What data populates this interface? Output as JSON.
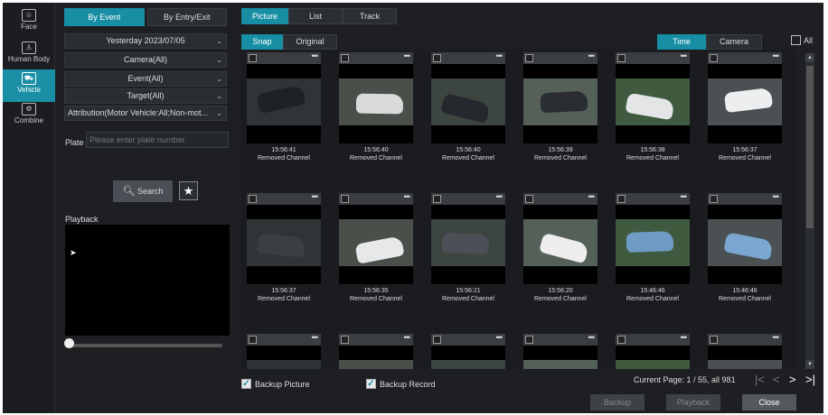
{
  "nav": [
    {
      "label": "Face",
      "icon": "face-icon",
      "glyph": "☺"
    },
    {
      "label": "Human Body",
      "icon": "human-body-icon",
      "glyph": "♙"
    },
    {
      "label": "Vehicle",
      "icon": "vehicle-icon",
      "glyph": "⛟"
    },
    {
      "label": "Combine",
      "icon": "combine-icon",
      "glyph": "⚙"
    }
  ],
  "left": {
    "tabs": [
      "By Event",
      "By Entry/Exit"
    ],
    "date": "Yesterday 2023/07/05",
    "camera": "Camera(All)",
    "event": "Event(All)",
    "target": "Target(All)",
    "attribution": "Attribution(Motor Vehicle:All;Non-mot...",
    "plate_label": "Plate",
    "plate_placeholder": "Please enter plate number",
    "search_label": "Search",
    "playback_label": "Playback"
  },
  "main": {
    "view_tabs": [
      "Picture",
      "List",
      "Track"
    ],
    "mode_tabs": [
      "Snap",
      "Original"
    ],
    "sort": {
      "time": "Time",
      "camera": "Camera"
    },
    "all_label": "All",
    "cards": [
      {
        "time": "15:56:41",
        "channel": "Removed Channel",
        "color": "#1e2226"
      },
      {
        "time": "15:56:40",
        "channel": "Removed Channel",
        "color": "#d8dadc"
      },
      {
        "time": "15:56:40",
        "channel": "Removed Channel",
        "color": "#25292d"
      },
      {
        "time": "15:56:39",
        "channel": "Removed Channel",
        "color": "#2a2d31"
      },
      {
        "time": "15:56:38",
        "channel": "Removed Channel",
        "color": "#e3e5e7"
      },
      {
        "time": "15:56:37",
        "channel": "Removed Channel",
        "color": "#eceeef"
      },
      {
        "time": "15:56:37",
        "channel": "Removed Channel",
        "color": "#3a3f44"
      },
      {
        "time": "15:56:35",
        "channel": "Removed Channel",
        "color": "#e6e8ea"
      },
      {
        "time": "15:56:21",
        "channel": "Removed Channel",
        "color": "#4a5056"
      },
      {
        "time": "15:56:20",
        "channel": "Removed Channel",
        "color": "#eeeeee"
      },
      {
        "time": "15:46:46",
        "channel": "Removed Channel",
        "color": "#6f9cc4"
      },
      {
        "time": "15:46:46",
        "channel": "Removed Channel",
        "color": "#7aa6cf"
      },
      {
        "time": "",
        "channel": "",
        "color": "#888"
      },
      {
        "time": "",
        "channel": "",
        "color": "#888"
      },
      {
        "time": "",
        "channel": "",
        "color": "#888"
      },
      {
        "time": "",
        "channel": "",
        "color": "#888"
      },
      {
        "time": "",
        "channel": "",
        "color": "#888"
      },
      {
        "time": "",
        "channel": "",
        "color": "#888"
      }
    ],
    "backup_picture": "Backup Picture",
    "backup_record": "Backup Record",
    "page_info": "Current Page: 1 / 55, all 981",
    "buttons": {
      "backup": "Backup",
      "playback": "Playback",
      "close": "Close"
    }
  }
}
